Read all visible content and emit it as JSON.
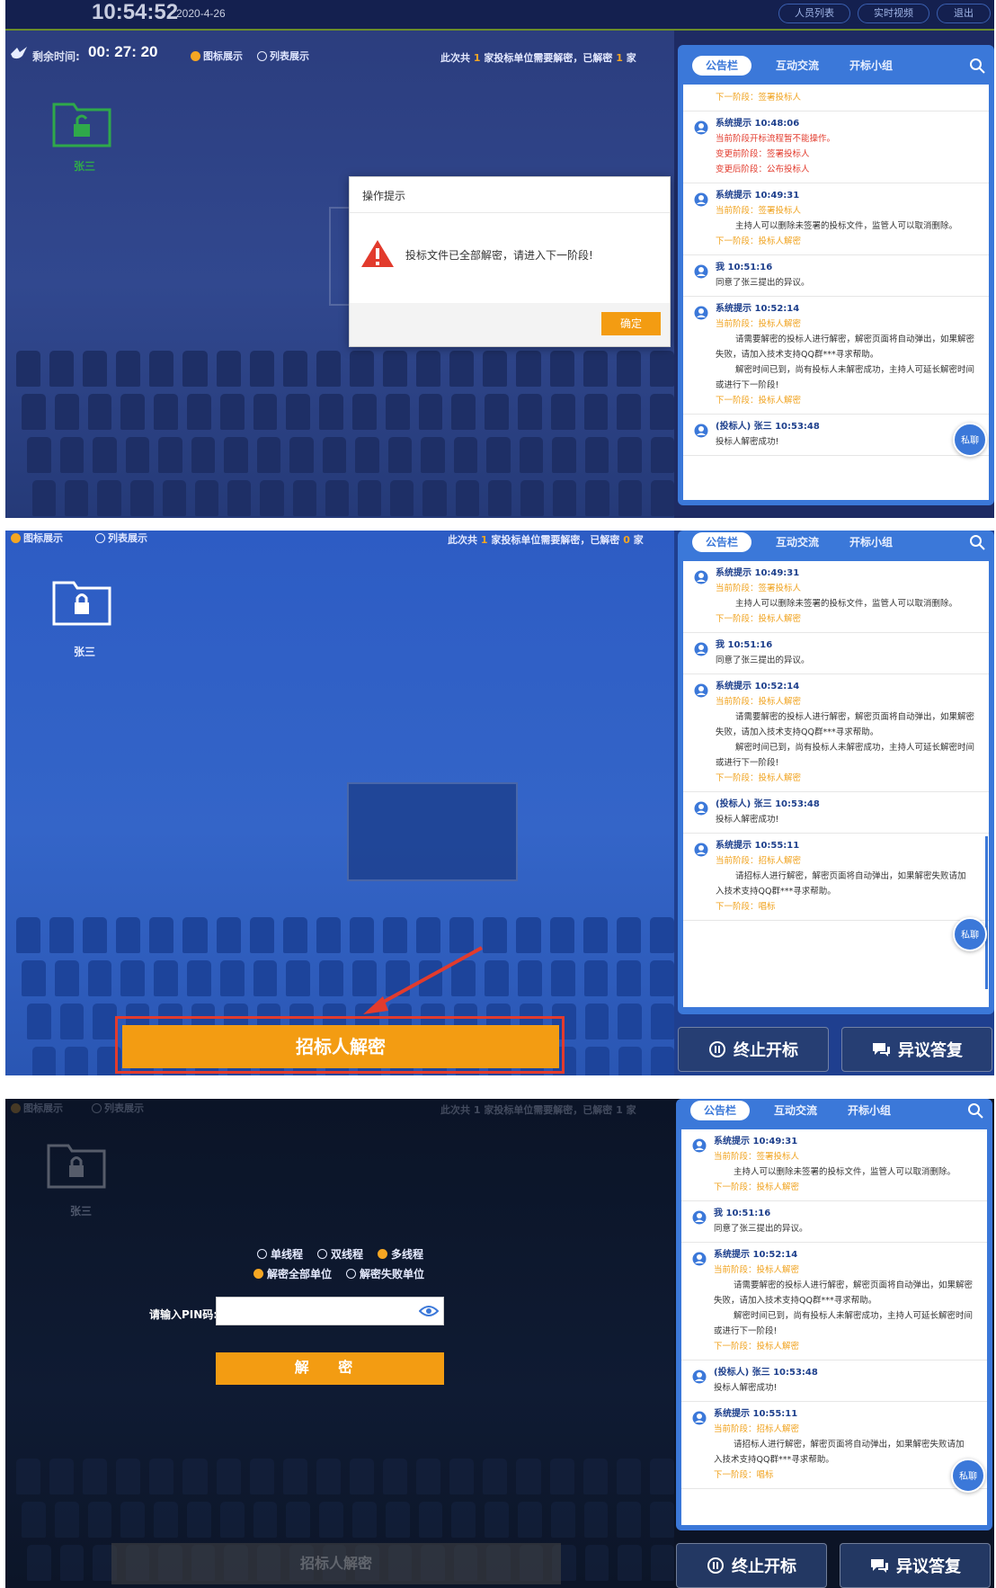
{
  "shot1": {
    "clock": "10:54:52",
    "date": "2020-4-26",
    "top_buttons": [
      "人员列表",
      "实时视频",
      "退出"
    ],
    "remain_label": "剩余时间:",
    "remain_time": "00: 27: 20",
    "view_options": [
      {
        "label": "图标展示",
        "selected": true
      },
      {
        "label": "列表展示",
        "selected": false
      }
    ],
    "count_prefix": "此次共",
    "count_total": "1",
    "count_middle": "家投标单位需要解密，已解密",
    "count_done": "1",
    "count_suffix": "家",
    "bidder_name": "张三",
    "modal": {
      "title": "操作提示",
      "message": "投标文件已全部解密，请进入下一阶段!",
      "ok_label": "确定"
    },
    "tabs": [
      "公告栏",
      "互动交流",
      "开标小组"
    ],
    "messages": [
      {
        "head": "",
        "lines": [
          {
            "t": "下一阶段：签署投标人",
            "c": "orange",
            "i": false
          }
        ]
      },
      {
        "head": "系统提示 10:48:06",
        "lines": [
          {
            "t": "当前阶段开标流程暂不能操作。",
            "c": "red",
            "i": false
          },
          {
            "t": "变更前阶段：签署投标人",
            "c": "red",
            "i": false
          },
          {
            "t": "变更后阶段：公布投标人",
            "c": "red",
            "i": false
          }
        ]
      },
      {
        "head": "系统提示 10:49:31",
        "lines": [
          {
            "t": "当前阶段：签署投标人",
            "c": "orange",
            "i": false
          },
          {
            "t": "主持人可以删除未签署的投标文件，监管人可以取消删除。",
            "c": "black",
            "i": true
          },
          {
            "t": "下一阶段：投标人解密",
            "c": "orange",
            "i": false
          }
        ]
      },
      {
        "head": "我 10:51:16",
        "lines": [
          {
            "t": "同意了张三提出的异议。",
            "c": "black",
            "i": false
          }
        ]
      },
      {
        "head": "系统提示 10:52:14",
        "lines": [
          {
            "t": "当前阶段：投标人解密",
            "c": "orange",
            "i": false
          },
          {
            "t": "请需要解密的投标人进行解密，解密页面将自动弹出，如果解密",
            "c": "black",
            "i": true
          },
          {
            "t": "失败，请加入技术支持QQ群***寻求帮助。",
            "c": "black",
            "i": false
          },
          {
            "t": "解密时间已到，尚有投标人未解密成功，主持人可延长解密时间",
            "c": "black",
            "i": true
          },
          {
            "t": "或进行下一阶段!",
            "c": "black",
            "i": false
          },
          {
            "t": "下一阶段：投标人解密",
            "c": "orange",
            "i": false
          }
        ]
      },
      {
        "head": "(投标人) 张三 10:53:48",
        "lines": [
          {
            "t": "投标人解密成功!",
            "c": "black",
            "i": false
          }
        ]
      }
    ],
    "chat_label": "私聊"
  },
  "shot2": {
    "view_options": [
      {
        "label": "图标展示",
        "selected": true
      },
      {
        "label": "列表展示",
        "selected": false
      }
    ],
    "count_prefix": "此次共",
    "count_total": "1",
    "count_middle": "家投标单位需要解密，已解密",
    "count_done": "0",
    "count_suffix": "家",
    "bidder_name": "张三",
    "tabs": [
      "公告栏",
      "互动交流",
      "开标小组"
    ],
    "messages": [
      {
        "head": "系统提示 10:49:31",
        "lines": [
          {
            "t": "当前阶段：签署投标人",
            "c": "orange",
            "i": false
          },
          {
            "t": "主持人可以删除未签署的投标文件，监管人可以取消删除。",
            "c": "black",
            "i": true
          },
          {
            "t": "下一阶段：投标人解密",
            "c": "orange",
            "i": false
          }
        ]
      },
      {
        "head": "我 10:51:16",
        "lines": [
          {
            "t": "同意了张三提出的异议。",
            "c": "black",
            "i": false
          }
        ]
      },
      {
        "head": "系统提示 10:52:14",
        "lines": [
          {
            "t": "当前阶段：投标人解密",
            "c": "orange",
            "i": false
          },
          {
            "t": "请需要解密的投标人进行解密，解密页面将自动弹出，如果解密",
            "c": "black",
            "i": true
          },
          {
            "t": "失败，请加入技术支持QQ群***寻求帮助。",
            "c": "black",
            "i": false
          },
          {
            "t": "解密时间已到，尚有投标人未解密成功，主持人可延长解密时间",
            "c": "black",
            "i": true
          },
          {
            "t": "或进行下一阶段!",
            "c": "black",
            "i": false
          },
          {
            "t": "下一阶段：投标人解密",
            "c": "orange",
            "i": false
          }
        ]
      },
      {
        "head": "(投标人) 张三 10:53:48",
        "lines": [
          {
            "t": "投标人解密成功!",
            "c": "black",
            "i": false
          }
        ]
      },
      {
        "head": "系统提示 10:55:11",
        "lines": [
          {
            "t": "当前阶段：招标人解密",
            "c": "orange",
            "i": false
          },
          {
            "t": "请招标人进行解密，解密页面将自动弹出，如果解密失败请加",
            "c": "black",
            "i": true
          },
          {
            "t": "入技术支持QQ群***寻求帮助。",
            "c": "black",
            "i": false
          },
          {
            "t": "下一阶段：唱标",
            "c": "orange",
            "i": false
          }
        ]
      }
    ],
    "chat_label": "私聊",
    "main_button": "招标人解密",
    "stop_button": "终止开标",
    "objection_button": "异议答复"
  },
  "shot3": {
    "view_options": [
      {
        "label": "图标展示",
        "selected": true
      },
      {
        "label": "列表展示",
        "selected": false
      }
    ],
    "count_text": "此次共 1 家投标单位需要解密，已解密 1 家",
    "bidder_name": "张三",
    "mode_options": [
      {
        "label": "单线程",
        "selected": false
      },
      {
        "label": "双线程",
        "selected": false
      },
      {
        "label": "多线程",
        "selected": true
      }
    ],
    "scope_options": [
      {
        "label": "解密全部单位",
        "selected": true
      },
      {
        "label": "解密失败单位",
        "selected": false
      }
    ],
    "pin_label": "请输入PIN码:",
    "pin_value": "",
    "decrypt_button": "解 密",
    "ghost_button": "招标人解密",
    "tabs": [
      "公告栏",
      "互动交流",
      "开标小组"
    ],
    "messages": [
      {
        "head": "系统提示 10:49:31",
        "lines": [
          {
            "t": "当前阶段：签署投标人",
            "c": "orange",
            "i": false
          },
          {
            "t": "主持人可以删除未签署的投标文件，监管人可以取消删除。",
            "c": "black",
            "i": true
          },
          {
            "t": "下一阶段：投标人解密",
            "c": "orange",
            "i": false
          }
        ]
      },
      {
        "head": "我 10:51:16",
        "lines": [
          {
            "t": "同意了张三提出的异议。",
            "c": "black",
            "i": false
          }
        ]
      },
      {
        "head": "系统提示 10:52:14",
        "lines": [
          {
            "t": "当前阶段：投标人解密",
            "c": "orange",
            "i": false
          },
          {
            "t": "请需要解密的投标人进行解密，解密页面将自动弹出，如果解密",
            "c": "black",
            "i": true
          },
          {
            "t": "失败，请加入技术支持QQ群***寻求帮助。",
            "c": "black",
            "i": false
          },
          {
            "t": "解密时间已到，尚有投标人未解密成功，主持人可延长解密时间",
            "c": "black",
            "i": true
          },
          {
            "t": "或进行下一阶段!",
            "c": "black",
            "i": false
          },
          {
            "t": "下一阶段：投标人解密",
            "c": "orange",
            "i": false
          }
        ]
      },
      {
        "head": "(投标人) 张三 10:53:48",
        "lines": [
          {
            "t": "投标人解密成功!",
            "c": "black",
            "i": false
          }
        ]
      },
      {
        "head": "系统提示 10:55:11",
        "lines": [
          {
            "t": "当前阶段：招标人解密",
            "c": "orange",
            "i": false
          },
          {
            "t": "请招标人进行解密，解密页面将自动弹出，如果解密失败请加",
            "c": "black",
            "i": true
          },
          {
            "t": "入技术支持QQ群***寻求帮助。",
            "c": "black",
            "i": false
          },
          {
            "t": "下一阶段：唱标",
            "c": "orange",
            "i": false
          }
        ]
      }
    ],
    "chat_label": "私聊",
    "stop_button": "终止开标",
    "objection_button": "异议答复"
  },
  "colors": {
    "accent_orange": "#f39c12",
    "panel_blue": "#3b78d9",
    "warning_red": "#e23b2d"
  }
}
